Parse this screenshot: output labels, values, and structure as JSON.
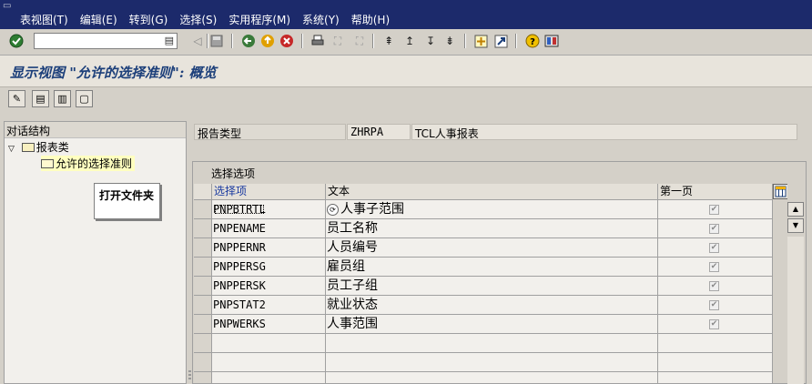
{
  "menubar": {
    "items": [
      "表视图(T)",
      "编辑(E)",
      "转到(G)",
      "选择(S)",
      "实用程序(M)",
      "系统(Y)",
      "帮助(H)"
    ]
  },
  "toolbar": {
    "command_value": "",
    "icons": [
      "enter-icon",
      "back-icon",
      "exit-icon",
      "cancel-icon",
      "print-icon",
      "find-icon",
      "find-next-icon",
      "first-page-icon",
      "prev-page-icon",
      "next-page-icon",
      "last-page-icon",
      "create-session-icon",
      "shortcut-icon",
      "help-icon",
      "layout-icon"
    ]
  },
  "title": "显示视图 \"允许的选择准则\": 概览",
  "app_toolbar": {
    "icons": [
      "display-change-icon",
      "select-all-icon",
      "select-block-icon",
      "deselect-all-icon"
    ]
  },
  "dialog_structure": {
    "header": "对话结构",
    "root": "报表类",
    "child": "允许的选择准则"
  },
  "tooltip": "打开文件夹",
  "report": {
    "label": "报告类型",
    "code": "ZHRPA",
    "description": "TCL人事报表"
  },
  "selection": {
    "caption": "选择选项",
    "columns": [
      "选择项",
      "文本",
      "第一页"
    ],
    "rows": [
      {
        "option": "PNPBTRTL",
        "text": "人事子范围",
        "first_page": true
      },
      {
        "option": "PNPENAME",
        "text": "员工名称",
        "first_page": true
      },
      {
        "option": "PNPPERNR",
        "text": "人员编号",
        "first_page": true
      },
      {
        "option": "PNPPERSG",
        "text": "雇员组",
        "first_page": true
      },
      {
        "option": "PNPPERSK",
        "text": "员工子组",
        "first_page": true
      },
      {
        "option": "PNPSTAT2",
        "text": "就业状态",
        "first_page": true
      },
      {
        "option": "PNPWERKS",
        "text": "人事范围",
        "first_page": true
      }
    ]
  }
}
